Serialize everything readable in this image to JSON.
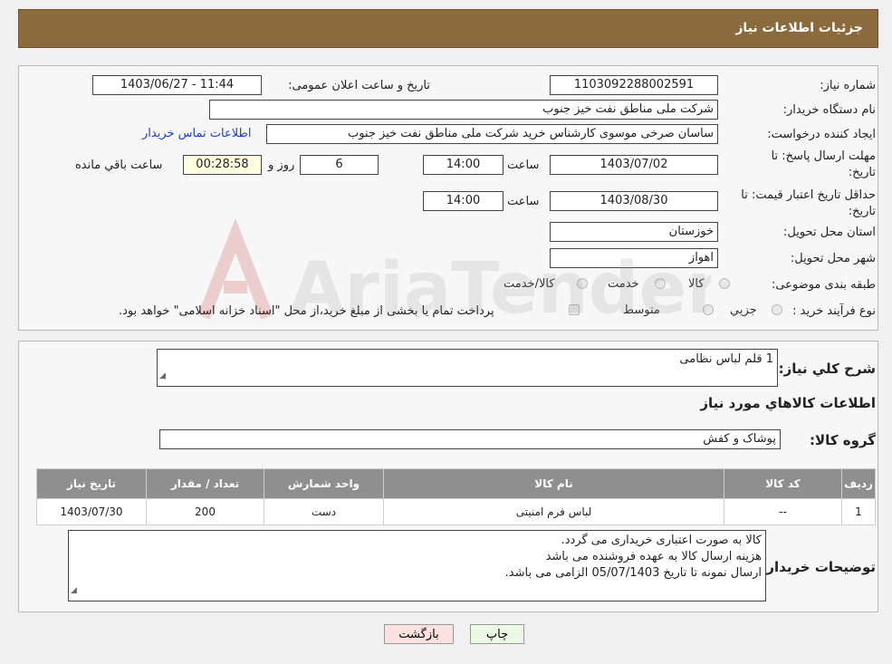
{
  "header": {
    "title": "جزئیات اطلاعات نیاز"
  },
  "form": {
    "need_number_label": "شماره نیاز:",
    "need_number": "1103092288002591",
    "announce_label": "تاریخ و ساعت اعلان عمومی:",
    "announce_value": "1403/06/27 - 11:44",
    "buyer_org_label": "نام دستگاه خریدار:",
    "buyer_org": "شرکت ملی مناطق نفت خیز جنوب",
    "requester_label": "ایجاد کننده درخواست:",
    "requester": "ساسان صرخی موسوی کارشناس خرید  شرکت ملی مناطق نفت خیز جنوب",
    "contact_link": "اطلاعات تماس خریدار",
    "deadline_label_1": "مهلت ارسال پاسخ: تا",
    "deadline_label_2": "تاریخ:",
    "deadline_date": "1403/07/02",
    "time_label": "ساعت",
    "deadline_time": "14:00",
    "days": "6",
    "days_label": "روز و",
    "remaining": "00:28:58",
    "remaining_label": "ساعت باقي مانده",
    "validity_label_1": "حداقل تاریخ اعتبار قیمت: تا",
    "validity_label_2": "تاریخ:",
    "validity_date": "1403/08/30",
    "validity_time": "14:00",
    "province_label": "استان محل تحویل:",
    "province": "خوزستان",
    "city_label": "شهر محل تحویل:",
    "city": "اهواز",
    "category_label": "طبقه بندی موضوعی:",
    "category_options": [
      "کالا",
      "خدمت",
      "کالا/خدمت"
    ],
    "process_label": "نوع فرآیند خرید :",
    "process_options": [
      "جزیي",
      "متوسط"
    ],
    "process_note": "پرداخت تمام یا بخشی از مبلغ خرید،از محل \"اسناد خزانه اسلامی\" خواهد بود."
  },
  "summary": {
    "desc_label": "شرح کلي نياز:",
    "desc": "1 قلم لباس نظامی",
    "items_title": "اطلاعات کالاهاي مورد نياز",
    "group_label": "گروه کالا:",
    "group": "پوشاک و کفش"
  },
  "table": {
    "headers": [
      "رديف",
      "کد کالا",
      "نام کالا",
      "واحد شمارش",
      "تعداد / مقدار",
      "تاریخ نیاز"
    ],
    "rows": [
      [
        "1",
        "--",
        "لباس فرم امنیتی",
        "دست",
        "200",
        "1403/07/30"
      ]
    ]
  },
  "notes": {
    "label": "توضیحات خریدار:",
    "lines": [
      "کالا به صورت اعتباری خریداری می گردد.",
      "هزینه ارسال کالا به عهده فروشنده می باشد",
      "ارسال نمونه تا تاریخ 05/07/1403 الزامی می باشد."
    ]
  },
  "buttons": {
    "print": "چاپ",
    "back": "بازگشت"
  },
  "watermark": {
    "text": "AriaTender.neT"
  },
  "colors": {
    "header": "#8b6a3e",
    "table_header": "#8f8f8f",
    "link": "#1a3fd8",
    "print_btn": "#eaf9e4",
    "back_btn": "#fde0e0"
  }
}
